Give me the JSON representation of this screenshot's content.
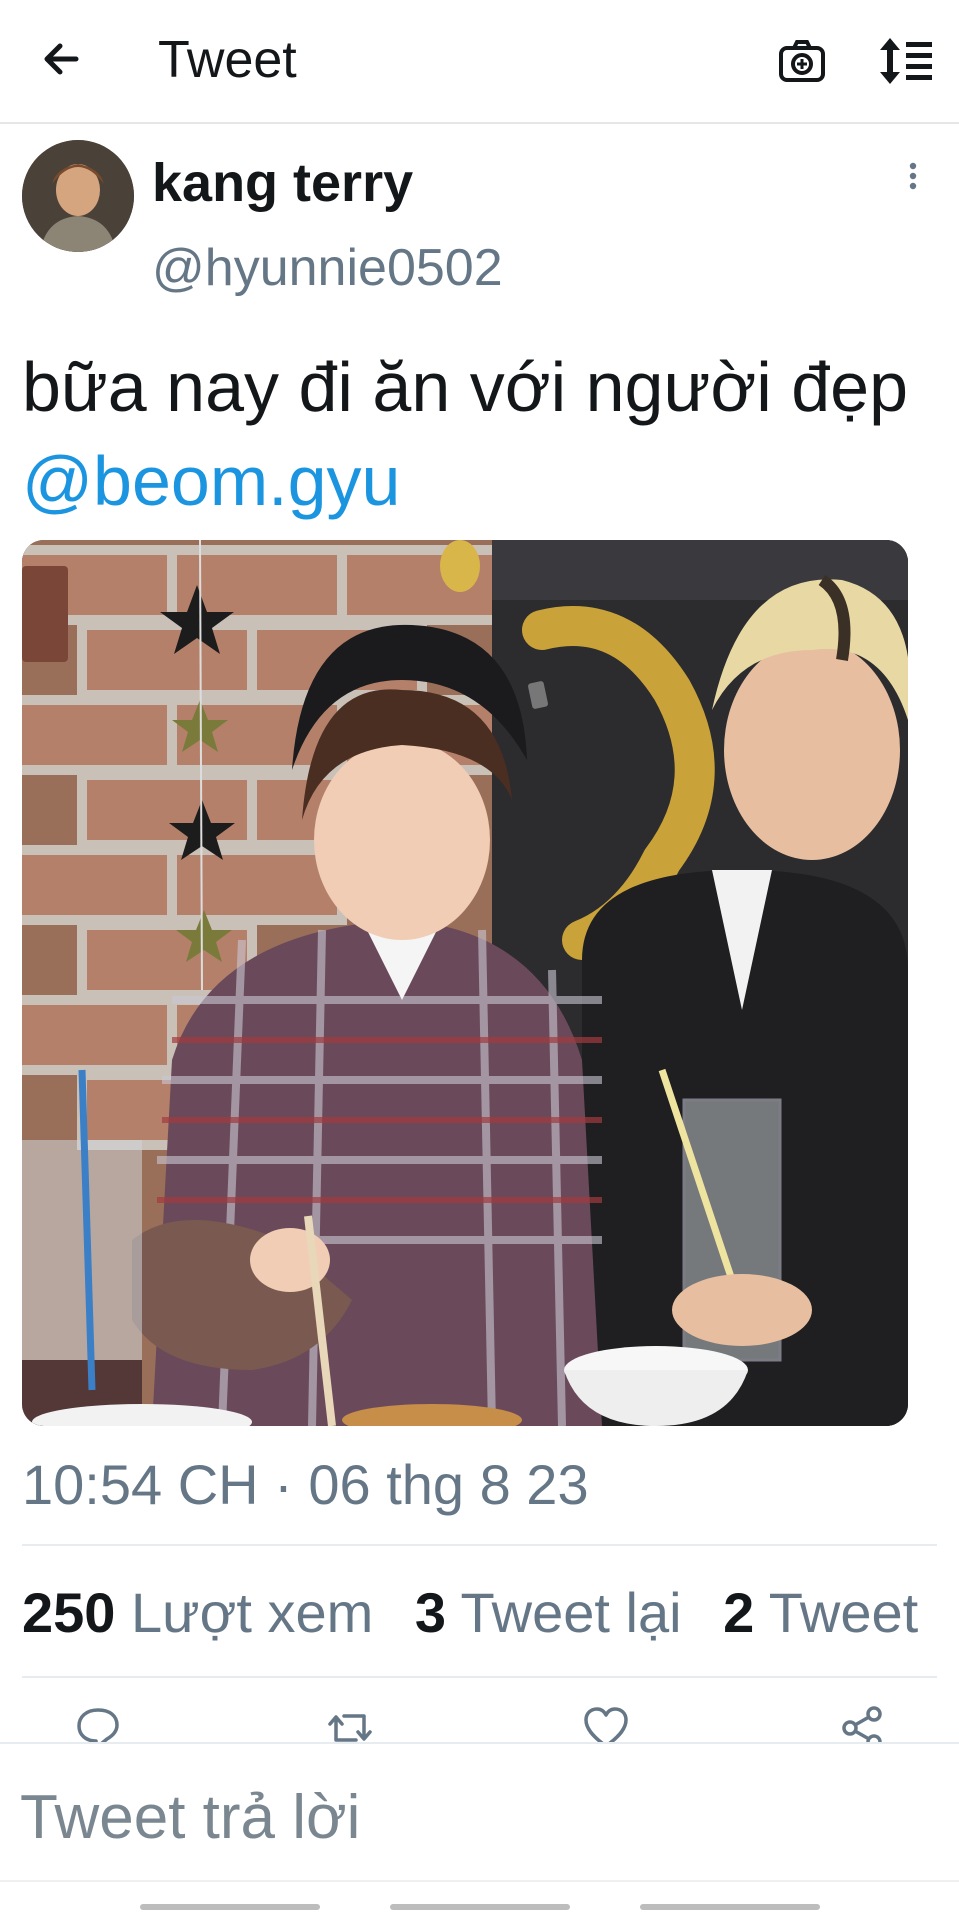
{
  "header": {
    "title": "Tweet",
    "back_icon": "arrow-left-icon",
    "camera_icon": "camera-icon",
    "sort_icon": "sort-icon"
  },
  "tweet": {
    "author": {
      "display_name": "kang terry",
      "handle": "@hyunnie0502"
    },
    "text": "bữa nay đi ăn với người đẹp",
    "mention": "@beom.gyu",
    "timestamp": "10:54 CH · 06 thg 8 23",
    "stats": {
      "views_count": "250",
      "views_label": "Lượt xem",
      "retweets_count": "3",
      "retweets_label": "Tweet lại",
      "quotes_count": "2",
      "quotes_label": "Tweet"
    }
  },
  "actions": [
    "reply-icon",
    "retweet-icon",
    "like-icon",
    "share-icon"
  ],
  "reply": {
    "placeholder": "Tweet trả lời"
  },
  "colors": {
    "text": "#14171a",
    "secondary": "#657786",
    "link": "#1b95e0",
    "divider": "#e6ecf0"
  }
}
